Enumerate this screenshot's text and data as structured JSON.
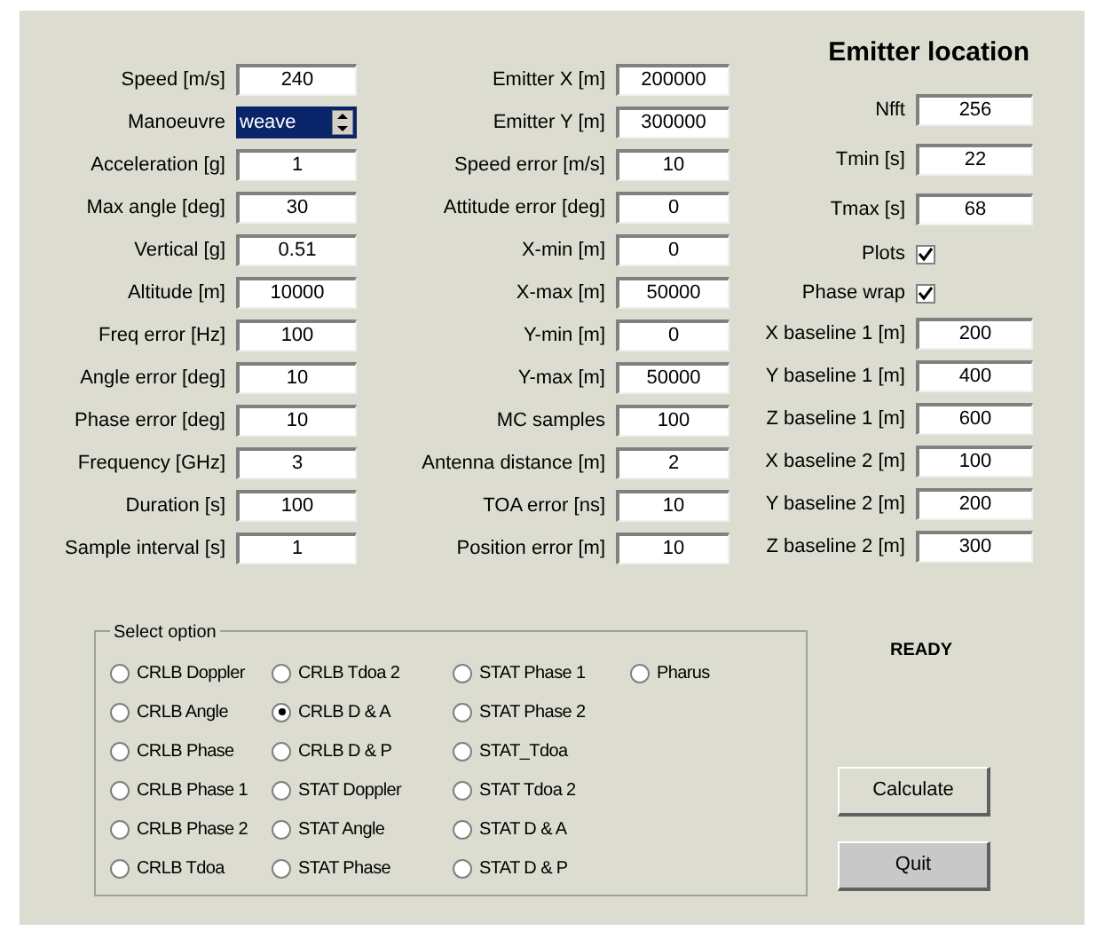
{
  "left_fields": [
    {
      "label": "Speed [m/s]",
      "value": "240",
      "kind": "field"
    },
    {
      "label": "Manoeuvre",
      "value": "weave",
      "kind": "spinner"
    },
    {
      "label": "Acceleration [g]",
      "value": "1",
      "kind": "field"
    },
    {
      "label": "Max angle [deg]",
      "value": "30",
      "kind": "field"
    },
    {
      "label": "Vertical [g]",
      "value": "0.51",
      "kind": "field"
    },
    {
      "label": "Altitude [m]",
      "value": "10000",
      "kind": "field"
    },
    {
      "label": "Freq error [Hz]",
      "value": "100",
      "kind": "field"
    },
    {
      "label": "Angle error [deg]",
      "value": "10",
      "kind": "field"
    },
    {
      "label": "Phase error [deg]",
      "value": "10",
      "kind": "field"
    },
    {
      "label": "Frequency [GHz]",
      "value": "3",
      "kind": "field"
    },
    {
      "label": "Duration [s]",
      "value": "100",
      "kind": "field"
    },
    {
      "label": "Sample interval [s]",
      "value": "1",
      "kind": "field"
    }
  ],
  "middle_fields": [
    {
      "label": "Emitter X [m]",
      "value": "200000"
    },
    {
      "label": "Emitter Y [m]",
      "value": "300000"
    },
    {
      "label": "Speed error [m/s]",
      "value": "10"
    },
    {
      "label": "Attitude error [deg]",
      "value": "0"
    },
    {
      "label": "X-min [m]",
      "value": "0"
    },
    {
      "label": "X-max [m]",
      "value": "50000"
    },
    {
      "label": "Y-min [m]",
      "value": "0"
    },
    {
      "label": "Y-max [m]",
      "value": "50000"
    },
    {
      "label": "MC samples",
      "value": "100"
    },
    {
      "label": "Antenna distance [m]",
      "value": "2"
    },
    {
      "label": "TOA error [ns]",
      "value": "10"
    },
    {
      "label": "Position error [m]",
      "value": "10"
    }
  ],
  "right_panel": {
    "title": "Emitter location",
    "fields": [
      {
        "label": "Nfft",
        "value": "256",
        "kind": "field"
      },
      {
        "label": "Tmin [s]",
        "value": "22",
        "kind": "field"
      },
      {
        "label": "Tmax [s]",
        "value": "68",
        "kind": "field"
      },
      {
        "label": "Plots",
        "checked": true,
        "kind": "checkbox"
      },
      {
        "label": "Phase wrap",
        "checked": true,
        "kind": "checkbox"
      },
      {
        "label": "X baseline 1 [m]",
        "value": "200",
        "kind": "field"
      },
      {
        "label": "Y baseline 1 [m]",
        "value": "400",
        "kind": "field"
      },
      {
        "label": "Z baseline 1 [m]",
        "value": "600",
        "kind": "field"
      },
      {
        "label": "X baseline 2 [m]",
        "value": "100",
        "kind": "field"
      },
      {
        "label": "Y baseline 2 [m]",
        "value": "200",
        "kind": "field"
      },
      {
        "label": "Z baseline 2 [m]",
        "value": "300",
        "kind": "field"
      }
    ]
  },
  "select_option": {
    "title": "Select option",
    "columns": [
      [
        {
          "label": "CRLB Doppler",
          "selected": false
        },
        {
          "label": "CRLB Angle",
          "selected": false
        },
        {
          "label": "CRLB Phase",
          "selected": false
        },
        {
          "label": "CRLB Phase 1",
          "selected": false
        },
        {
          "label": "CRLB Phase 2",
          "selected": false
        },
        {
          "label": "CRLB Tdoa",
          "selected": false
        }
      ],
      [
        {
          "label": "CRLB Tdoa 2",
          "selected": false
        },
        {
          "label": "CRLB D & A",
          "selected": true
        },
        {
          "label": "CRLB D & P",
          "selected": false
        },
        {
          "label": "STAT Doppler",
          "selected": false
        },
        {
          "label": "STAT Angle",
          "selected": false
        },
        {
          "label": "STAT Phase",
          "selected": false
        }
      ],
      [
        {
          "label": "STAT Phase 1",
          "selected": false
        },
        {
          "label": "STAT Phase 2",
          "selected": false
        },
        {
          "label": "STAT_Tdoa",
          "selected": false
        },
        {
          "label": "STAT Tdoa 2",
          "selected": false
        },
        {
          "label": "STAT D & A",
          "selected": false
        },
        {
          "label": "STAT D & P",
          "selected": false
        }
      ],
      [
        {
          "label": "Pharus",
          "selected": false
        }
      ]
    ]
  },
  "status": "READY",
  "buttons": [
    {
      "label": "Calculate",
      "pressed": false
    },
    {
      "label": "Quit",
      "pressed": true
    }
  ]
}
